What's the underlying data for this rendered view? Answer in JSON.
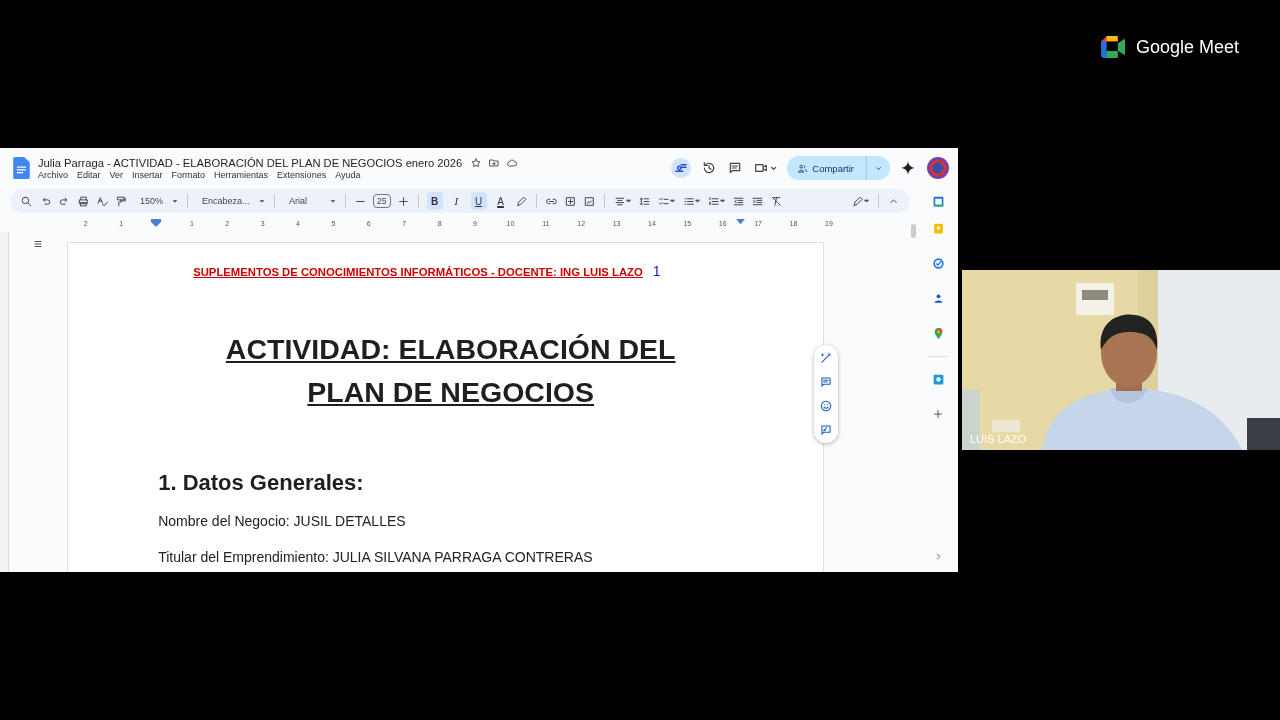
{
  "meet": {
    "brand": "Google Meet"
  },
  "doc": {
    "title": "Julia Parraga - ACTIVIDAD - ELABORACIÓN DEL PLAN DE NEGOCIOS enero 2026",
    "menu": [
      "Archivo",
      "Editar",
      "Ver",
      "Insertar",
      "Formato",
      "Herramientas",
      "Extensiones",
      "Ayuda"
    ],
    "share_button": "Compartir",
    "toolbar": {
      "zoom": "150%",
      "style": "Encabeza...",
      "font": "Arial",
      "font_size": "25",
      "format_buttons": [
        {
          "label": "B",
          "selected": true
        },
        {
          "label": "I",
          "selected": false
        },
        {
          "label": "U",
          "selected": true
        }
      ],
      "text_color": "A"
    },
    "ruler": {
      "left_labels": [
        "2",
        "1"
      ],
      "labels": [
        "1",
        "2",
        "3",
        "4",
        "5",
        "6",
        "7",
        "8",
        "9",
        "10",
        "11",
        "12",
        "13",
        "14",
        "15",
        "16",
        "17",
        "18",
        "19"
      ]
    },
    "page": {
      "header": "SUPLEMENTOS DE CONOCIMIENTOS INFORMÁTICOS - DOCENTE: ING LUIS LAZO",
      "footnote_mark": "1",
      "title": "ACTIVIDAD: ELABORACIÓN DEL PLAN DE NEGOCIOS",
      "section": "1. Datos Generales:",
      "lines": [
        "Nombre del Negocio: JUSIL DETALLES",
        "Titular del Emprendimiento: JULIA SILVANA PARRAGA CONTRERAS"
      ]
    }
  },
  "participant": {
    "name": "LUIS LAZO"
  }
}
